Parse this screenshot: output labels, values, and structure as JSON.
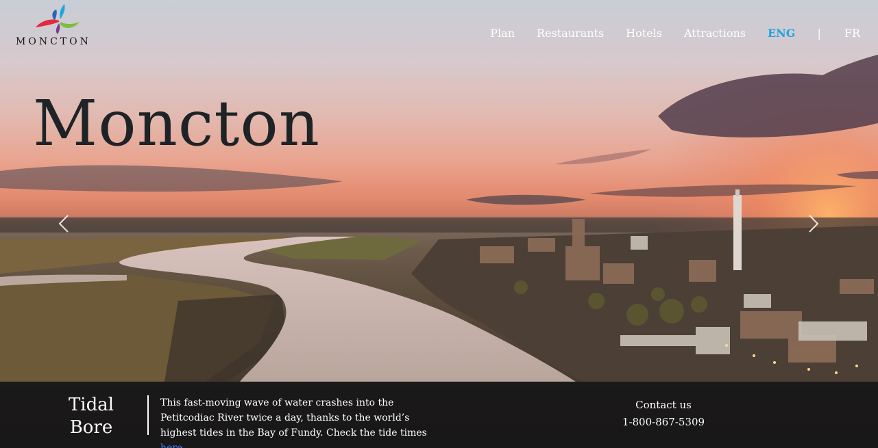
{
  "nav": {
    "items": [
      {
        "label": "Plan"
      },
      {
        "label": "Restaurants"
      },
      {
        "label": "Hotels"
      },
      {
        "label": "Attractions"
      }
    ],
    "lang_en": "ENG",
    "separator": "|",
    "lang_fr": "FR",
    "active_color": "#1fa4e0"
  },
  "logo": {
    "word": "MONCTON",
    "icon": "moncton-star-logo"
  },
  "hero": {
    "title": "Moncton"
  },
  "carousel": {
    "prev_icon": "chevron-left-icon",
    "next_icon": "chevron-right-icon"
  },
  "feature": {
    "title_line1": "Tidal",
    "title_line2": "Bore",
    "description": "This fast-moving wave of water crashes into the Petitcodiac River twice a day, thanks to the world’s highest tides in the Bay of Fundy. Check the tide times ",
    "link_text": "here",
    "after_link": "."
  },
  "contact": {
    "label": "Contact us",
    "phone": "1-800-867-5309"
  }
}
